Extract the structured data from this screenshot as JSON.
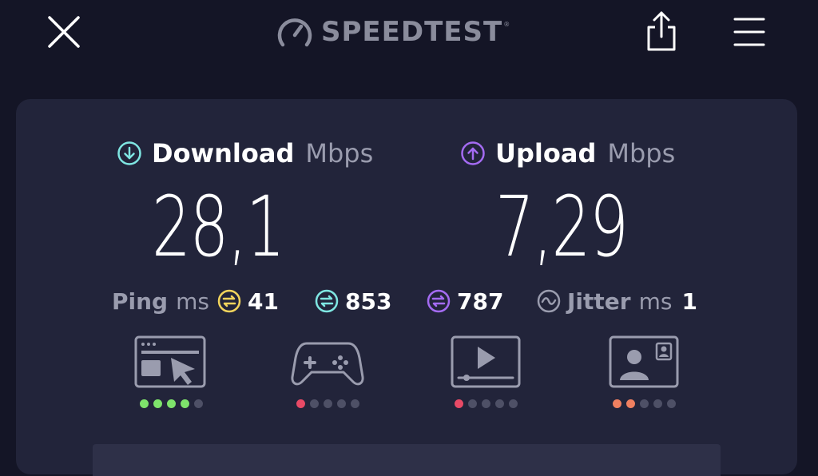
{
  "header": {
    "brand": "SPEEDTEST",
    "brand_tm": "®",
    "close_icon": "close-icon",
    "share_icon": "share-icon",
    "menu_icon": "hamburger-menu-icon"
  },
  "download": {
    "title": "Download",
    "unit": "Mbps",
    "value": "28,1",
    "icon": "download-arrow-icon",
    "color": "#7fe6e2"
  },
  "upload": {
    "title": "Upload",
    "unit": "Mbps",
    "value": "7,29",
    "icon": "upload-arrow-icon",
    "color": "#a46bf2"
  },
  "ping": {
    "label": "Ping",
    "unit": "ms",
    "idle_value": "41",
    "download_value": "853",
    "upload_value": "787",
    "colors": {
      "idle": "#f2d45c",
      "download": "#7fe6e2",
      "upload": "#a46bf2"
    }
  },
  "jitter": {
    "label": "Jitter",
    "unit": "ms",
    "value": "1"
  },
  "app_ratings": [
    {
      "name": "web-browsing",
      "icon": "web-browsing-icon",
      "score": 4,
      "max": 5,
      "color": "#7ee36b"
    },
    {
      "name": "gaming",
      "icon": "gamepad-icon",
      "score": 1,
      "max": 5,
      "color": "#e84a66"
    },
    {
      "name": "video-streaming",
      "icon": "video-play-icon",
      "score": 1,
      "max": 5,
      "color": "#e84a66"
    },
    {
      "name": "video-call",
      "icon": "video-call-icon",
      "score": 2,
      "max": 5,
      "color": "#f08060"
    }
  ]
}
